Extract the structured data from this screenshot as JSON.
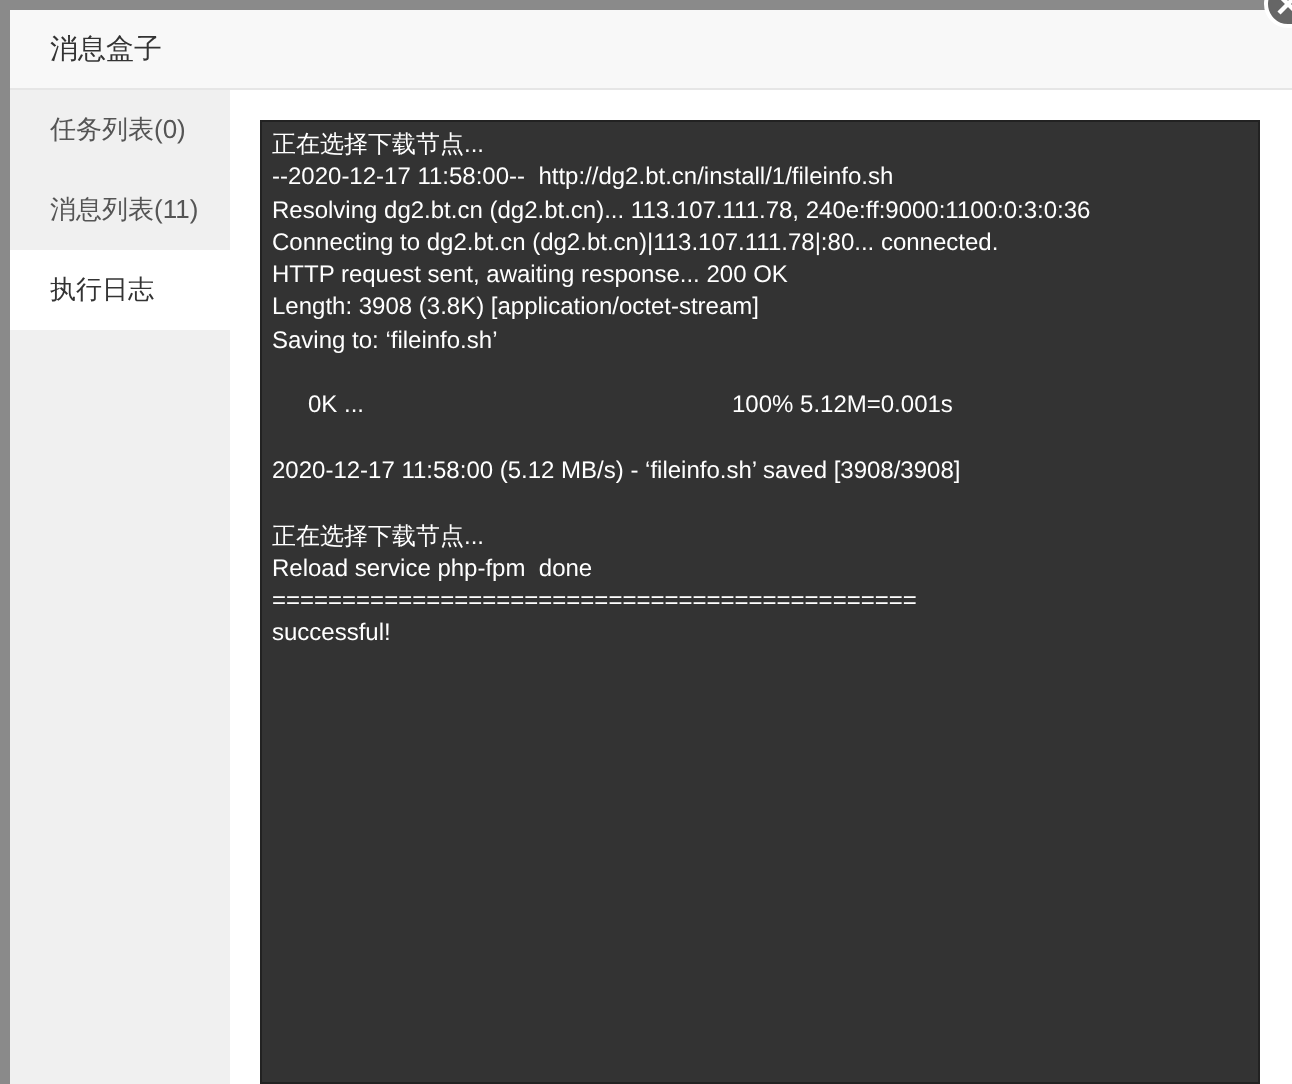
{
  "dialog": {
    "title": "消息盒子"
  },
  "tabs": [
    {
      "label": "任务列表(0)",
      "selected": false
    },
    {
      "label": "消息列表(11)",
      "selected": false
    },
    {
      "label": "执行日志",
      "selected": true
    }
  ],
  "log": {
    "groups": [
      [
        {
          "kind": "text",
          "text": "正在选择下载节点..."
        },
        {
          "kind": "text",
          "text": "--2020-12-17 11:58:00--  http://dg2.bt.cn/install/1/fileinfo.sh"
        },
        {
          "kind": "text",
          "text": "Resolving dg2.bt.cn (dg2.bt.cn)... 113.107.111.78, 240e:ff:9000:1100:0:3:0:36"
        },
        {
          "kind": "text",
          "text": "Connecting to dg2.bt.cn (dg2.bt.cn)|113.107.111.78|:80... connected."
        },
        {
          "kind": "text",
          "text": "HTTP request sent, awaiting response... 200 OK"
        },
        {
          "kind": "text",
          "text": "Length: 3908 (3.8K) [application/octet-stream]"
        },
        {
          "kind": "text",
          "text": "Saving to: ‘fileinfo.sh’"
        }
      ],
      [
        {
          "kind": "progress",
          "size": "0K ...",
          "stats": "100% 5.12M=0.001s"
        }
      ],
      [
        {
          "kind": "text",
          "text": "2020-12-17 11:58:00 (5.12 MB/s) - ‘fileinfo.sh’ saved [3908/3908]"
        }
      ],
      [
        {
          "kind": "text",
          "text": "正在选择下载节点..."
        },
        {
          "kind": "text",
          "text": "Reload service php-fpm  done"
        },
        {
          "kind": "text",
          "text": "=============================================="
        },
        {
          "kind": "text",
          "text": "successful!"
        }
      ]
    ]
  }
}
